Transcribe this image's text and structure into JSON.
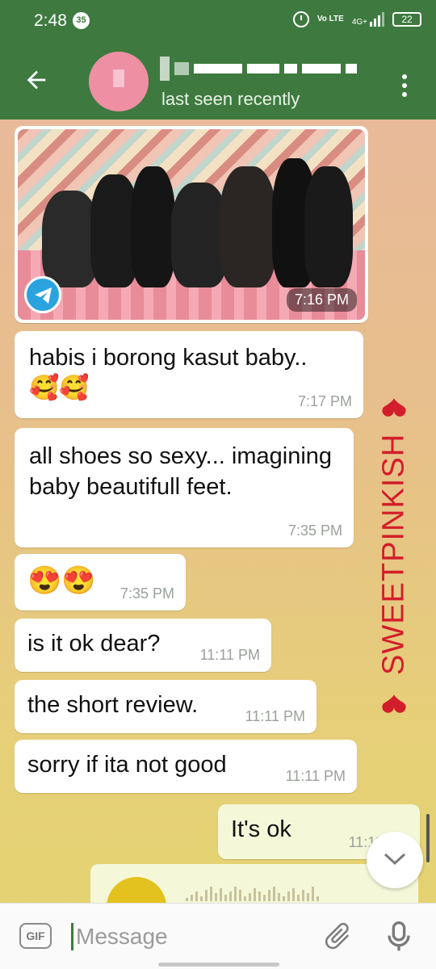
{
  "status_bar": {
    "time": "2:48",
    "notification_count": "35",
    "volte": "Vo LTE",
    "network": "4G+",
    "battery": "22"
  },
  "header": {
    "last_seen": "last seen recently"
  },
  "messages": [
    {
      "type": "photo",
      "time": "7:16 PM",
      "direction": "in"
    },
    {
      "type": "text",
      "text": "habis i borong kasut baby..",
      "emoji": "🥰🥰",
      "time": "7:17 PM",
      "direction": "in"
    },
    {
      "type": "text",
      "text": "all shoes so sexy... imagining baby beautifull feet.",
      "time": "7:35 PM",
      "direction": "in"
    },
    {
      "type": "emoji",
      "text": "😍😍",
      "time": "7:35 PM",
      "direction": "in"
    },
    {
      "type": "text",
      "text": "is it ok dear?",
      "time": "11:11 PM",
      "direction": "in"
    },
    {
      "type": "text",
      "text": "the short review.",
      "time": "11:11 PM",
      "direction": "in"
    },
    {
      "type": "text",
      "text": "sorry if ita not good",
      "time": "11:11 PM",
      "direction": "in"
    },
    {
      "type": "text",
      "text": "It's ok",
      "time": "11:11 PM",
      "direction": "out"
    }
  ],
  "watermark": "SWEETPINKISH",
  "input": {
    "gif_label": "GIF",
    "placeholder": "Message"
  },
  "colors": {
    "header": "#3e7a3f",
    "accent": "#2aa3df",
    "watermark": "#d21e2a"
  },
  "icons": [
    "back-arrow-icon",
    "more-vert-icon",
    "telegram-logo",
    "chevron-down-icon",
    "attach-icon",
    "mic-icon",
    "alarm-icon"
  ]
}
